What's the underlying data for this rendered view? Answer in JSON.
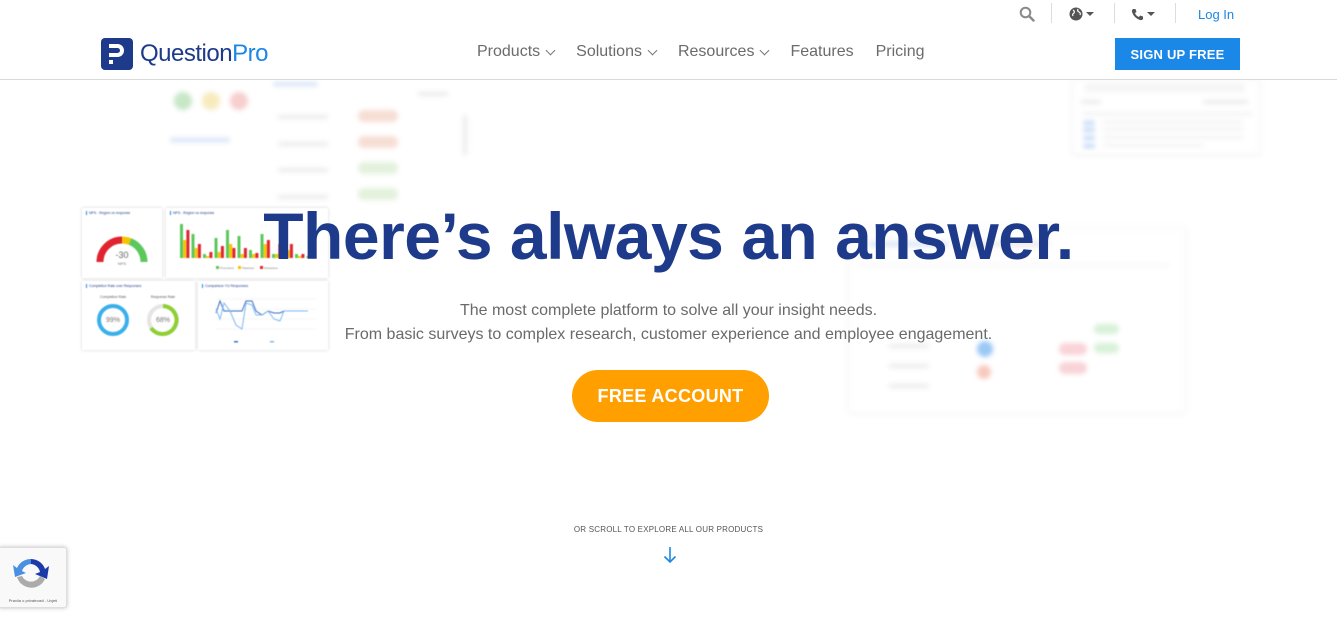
{
  "utility_bar": {
    "search_icon": "search-icon",
    "language_icon": "globe-icon",
    "phone_icon": "phone-icon",
    "login_label": "Log In"
  },
  "header": {
    "logo": {
      "text_part1": "Question",
      "text_part2": "Pro"
    },
    "nav": [
      {
        "label": "Products",
        "has_dropdown": true
      },
      {
        "label": "Solutions",
        "has_dropdown": true
      },
      {
        "label": "Resources",
        "has_dropdown": true
      },
      {
        "label": "Features",
        "has_dropdown": false
      },
      {
        "label": "Pricing",
        "has_dropdown": false
      }
    ],
    "signup_label": "SIGN UP FREE"
  },
  "hero": {
    "title": "There’s always an answer.",
    "subtitle_line1": "The most complete platform to solve all your insight needs.",
    "subtitle_line2": "From basic surveys to complex research, customer experience and employee engagement.",
    "cta_label": "FREE ACCOUNT"
  },
  "dashboard_preview": {
    "nps_gauge": {
      "title": "NPS - Region vs response",
      "value": "-30",
      "unit": "NPS"
    },
    "nps_bars": {
      "title": "NPS - Region vs response",
      "legend": [
        "Promoters",
        "Passives",
        "Detractors"
      ]
    },
    "completion": {
      "title": "Completion Rate over Responses",
      "completion_label": "Completion Rate",
      "completion_value": "99%",
      "response_label": "Response Rate",
      "response_value": "68%"
    },
    "comparison": {
      "title": "Comparison YU Responses"
    }
  },
  "scroll_hint": {
    "label": "OR SCROLL TO EXPLORE ALL OUR PRODUCTS",
    "icon": "arrow-down-icon"
  },
  "recaptcha": {
    "footer_text": "Pravila o privatnosti - Uvjeti"
  },
  "colors": {
    "brand_navy": "#1e3a8a",
    "brand_blue": "#1b87e6",
    "cta_orange": "#ff9f00"
  }
}
